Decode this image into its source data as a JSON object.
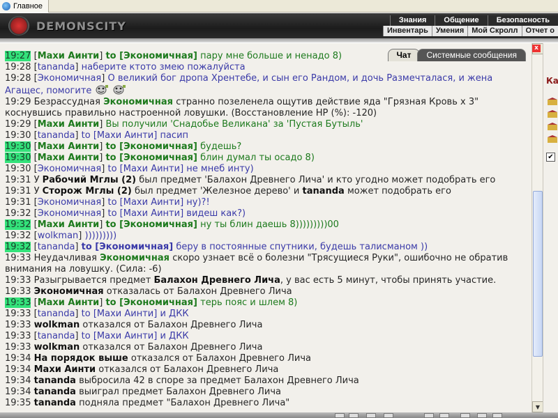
{
  "browser": {
    "tab_label": "Главное"
  },
  "header": {
    "logo": "DEMONSCITY",
    "menu_top": [
      "Знания",
      "Общение",
      "Безопасность"
    ],
    "menu_bottom": [
      "Инвентарь",
      "Умения",
      "Мой Скролл",
      "Отчет о"
    ]
  },
  "chat": {
    "tabs": [
      "Чат",
      "Системные сообщения"
    ],
    "lines": [
      {
        "time": "19:27",
        "hl": true,
        "type": "to",
        "from": "Махи Аинти",
        "to": "Экономичная",
        "text": "пару мне больше и ненадо 8)",
        "color": "green"
      },
      {
        "time": "19:28",
        "hl": false,
        "type": "self",
        "from": "tananda",
        "text": "наберите ктото змею пожалуйста",
        "color": "blue"
      },
      {
        "time": "19:28",
        "hl": false,
        "type": "self",
        "from": "Экономичная",
        "text": "О великий бог дропа Хрентебе, и сын его Рандом, и дочь Размечталася, и жена Агащес, помогите",
        "color": "blue",
        "wrap": true,
        "smiles": 2
      },
      {
        "time": "19:29",
        "hl": false,
        "type": "event",
        "pre": "Безрассудная",
        "who": "Экономичная",
        "text": "странно позеленела ощутив действие яда \"Грязная Кровь х 3\" коснувшись правильно настроенной ловушки. (Восстановление HP (%): -120)",
        "wrap": true
      },
      {
        "time": "19:29",
        "hl": false,
        "type": "self",
        "from": "Махи Аинти",
        "text": "Вы получили 'Снадобье Великана' за 'Пустая Бутыль'",
        "color": "green"
      },
      {
        "time": "19:30",
        "hl": false,
        "type": "to",
        "from": "tananda",
        "to": "Махи Аинти",
        "text": "пасип",
        "color": "blue"
      },
      {
        "time": "19:30",
        "hl": true,
        "type": "to",
        "from": "Махи Аинти",
        "to": "Экономичная",
        "text": "будешь?",
        "color": "green"
      },
      {
        "time": "19:30",
        "hl": true,
        "type": "to",
        "from": "Махи Аинти",
        "to": "Экономичная",
        "text": "блин думал ты осадо 8)",
        "color": "green"
      },
      {
        "time": "19:30",
        "hl": false,
        "type": "to",
        "from": "Экономичная",
        "to": "Махи Аинти",
        "text": "не мнеб инту)",
        "color": "blue"
      },
      {
        "time": "19:31",
        "hl": false,
        "type": "item",
        "pre": "У",
        "who": "Рабочий Мглы (2)",
        "text": "был предмет 'Балахон Древнего Лича' и кто угодно может подобрать его"
      },
      {
        "time": "19:31",
        "hl": false,
        "type": "item2",
        "pre": "У",
        "who": "Сторож Мглы (2)",
        "text": "был предмет 'Железное дерево' и",
        "who2": "tananda",
        "text2": "может подобрать его"
      },
      {
        "time": "19:31",
        "hl": false,
        "type": "to",
        "from": "Экономичная",
        "to": "Махи Аинти",
        "text": "ну)?!",
        "color": "blue"
      },
      {
        "time": "19:32",
        "hl": false,
        "type": "to",
        "from": "Экономичная",
        "to": "Махи Аинти",
        "text": "видеш как?)",
        "color": "blue"
      },
      {
        "time": "19:32",
        "hl": true,
        "type": "to",
        "from": "Махи Аинти",
        "to": "Экономичная",
        "text": "ну ты блин даешь 8)))))))))00",
        "color": "green"
      },
      {
        "time": "19:32",
        "hl": false,
        "type": "self",
        "from": "wolkman",
        "text": ")))))))))",
        "color": "blue"
      },
      {
        "time": "19:32",
        "hl": true,
        "type": "tob",
        "from": "tananda",
        "to": "Экономичная",
        "text": "беру в постоянные спутники, будешь талисманом ))",
        "color": "blue"
      },
      {
        "time": "19:33",
        "hl": false,
        "type": "event",
        "pre": "Неудачливая",
        "who": "Экономичная",
        "text": "скоро узнает всё о болезни \"Трясущиеся Руки\", ошибочно не обратив внимания на ловушку. (Сила: -6)",
        "wrap": true
      },
      {
        "time": "19:33",
        "hl": false,
        "type": "sys",
        "text": "Разыгрывается предмет",
        "who": "Балахон Древнего Лича",
        "text2": ", у вас есть 5 минут, чтобы принять участие."
      },
      {
        "time": "19:33",
        "hl": false,
        "type": "plain",
        "who": "Экономичная",
        "text": "отказалась от Балахон Древнего Лича"
      },
      {
        "time": "19:33",
        "hl": true,
        "type": "to",
        "from": "Махи Аинти",
        "to": "Экономичная",
        "text": "терь пояс и шлем 8)",
        "color": "green"
      },
      {
        "time": "19:33",
        "hl": false,
        "type": "to",
        "from": "tananda",
        "to": "Махи Аинти",
        "text": "и ДКК",
        "color": "blue"
      },
      {
        "time": "19:33",
        "hl": false,
        "type": "plain",
        "who": "wolkman",
        "text": "отказался от Балахон Древнего Лича"
      },
      {
        "time": "19:33",
        "hl": false,
        "type": "to",
        "from": "tananda",
        "to": "Махи Аинти",
        "text": "и ДКК",
        "color": "blue"
      },
      {
        "time": "19:33",
        "hl": false,
        "type": "plain",
        "who": "wolkman",
        "text": "отказался от Балахон Древнего Лича"
      },
      {
        "time": "19:34",
        "hl": false,
        "type": "plain",
        "who": "На порядок выше",
        "text": "отказался от Балахон Древнего Лича"
      },
      {
        "time": "19:34",
        "hl": false,
        "type": "plain",
        "who": "Махи Аинти",
        "text": "отказался от Балахон Древнего Лича"
      },
      {
        "time": "19:34",
        "hl": false,
        "type": "plain",
        "who": "tananda",
        "text": "выбросила 42 в споре за предмет Балахон Древнего Лича"
      },
      {
        "time": "19:34",
        "hl": false,
        "type": "plain",
        "who": "tananda",
        "text": "выиграл предмет Балахон Древнего Лича"
      },
      {
        "time": "19:35",
        "hl": false,
        "type": "plain",
        "who": "tananda",
        "text": "подняла предмет \"Балахон Древнего Лича\""
      }
    ]
  },
  "right_panel": {
    "title": "Ка",
    "close": "x",
    "check": "✔"
  }
}
